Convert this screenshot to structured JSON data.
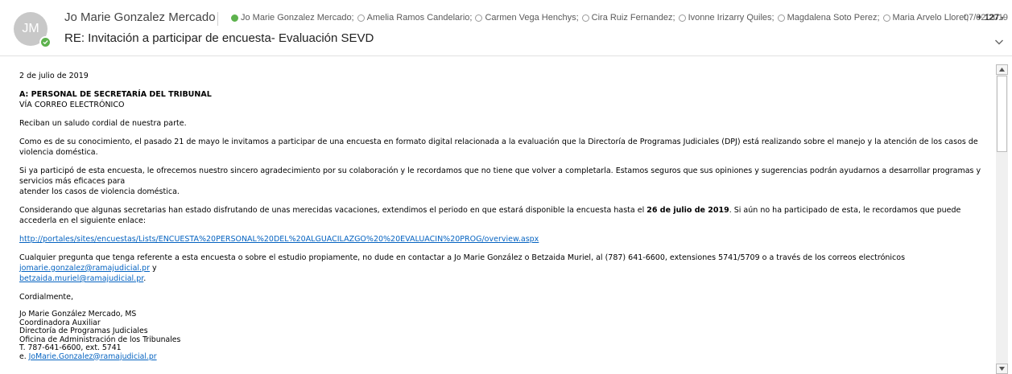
{
  "header": {
    "avatar_initials": "JM",
    "sender": "Jo Marie Gonzalez Mercado",
    "subject": "RE: Invitación a participar de encuesta- Evaluación SEVD",
    "date": "07/02/2019",
    "recipients": [
      {
        "name": "Jo Marie Gonzalez Mercado;",
        "online": true
      },
      {
        "name": "Amelia Ramos Candelario;",
        "online": false
      },
      {
        "name": "Carmen Vega Henchys;",
        "online": false
      },
      {
        "name": "Cira Ruiz Fernandez;",
        "online": false
      },
      {
        "name": "Ivonne Irizarry Quiles;",
        "online": false
      },
      {
        "name": "Magdalena Soto Perez;",
        "online": false
      },
      {
        "name": "Maria Arvelo Lloret;",
        "online": false
      }
    ],
    "more_recipients": "+ 127",
    "colors": {
      "online": "#5db24d",
      "link": "#0563c1"
    }
  },
  "body": {
    "date_line": "2 de julio de 2019",
    "to_line": "A: PERSONAL DE SECRETARÍA DEL TRIBUNAL",
    "via_line": "VÍA CORREO ELECTRÓNICO",
    "greeting": "Reciban un saludo cordial de nuestra parte.",
    "p1": "Como es de su conocimiento, el pasado 21 de mayo le invitamos a participar de una encuesta en formato digital relacionada a la evaluación que la Directoría de Programas Judiciales (DPJ) está realizando sobre el manejo y la atención de los casos de violencia doméstica.",
    "p2a": "Si ya participó de esta encuesta, le ofrecemos nuestro sincero agradecimiento por su colaboración y le recordamos que no tiene que volver a completarla. Estamos seguros que sus opiniones y sugerencias podrán ayudarnos a desarrollar programas y servicios más eficaces para",
    "p2b": "atender los casos de violencia doméstica.",
    "p3_pre": "Considerando que algunas secretarias han estado disfrutando de unas merecidas vacaciones, extendimos el periodo en que estará disponible la encuesta hasta el ",
    "p3_bold": "26 de julio de 2019",
    "p3_post": ". Si aún no ha participado de esta, le recordamos que puede accederla en el siguiente enlace:",
    "survey_link": "http://portales/sites/encuestas/Lists/ENCUESTA%20PERSONAL%20DEL%20ALGUACILAZGO%20%20EVALUACIN%20PROG/overview.aspx",
    "p4_pre": "Cualquier pregunta que tenga referente a esta encuesta o sobre el estudio propiamente, no dude en contactar a Jo Marie González o Betzaida Muriel, al (787) 641-6600, extensiones 5741/5709 o a través de los correos electrónicos ",
    "p4_email1": "jomarie.gonzalez@ramajudicial.pr",
    "p4_mid": " y",
    "p4_email2": "betzaida.muriel@ramajudicial.pr",
    "p4_end": ".",
    "closing": "Cordialmente,",
    "signature": {
      "name": "Jo Marie González Mercado, MS",
      "title": "Coordinadora Auxiliar",
      "dept": "Directoría de Programas Judiciales",
      "office": "Oficina de Administración de los Tribunales",
      "phone": "T. 787-641-6600, ext. 5741",
      "email_prefix": "e. ",
      "email": "JoMarie.Gonzalez@ramajudicial.pr"
    }
  }
}
